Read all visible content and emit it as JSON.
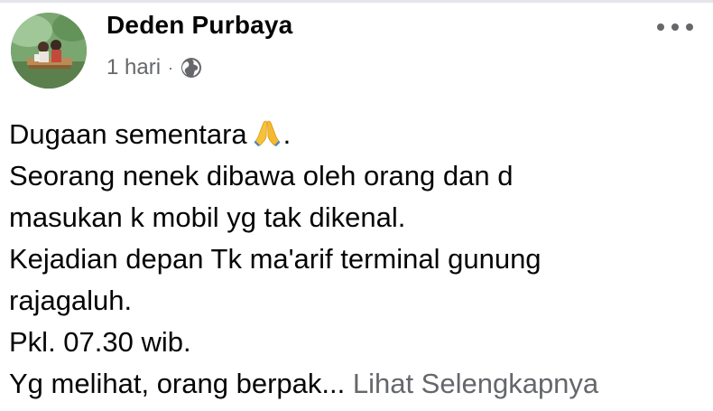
{
  "post": {
    "author": "Deden Purbaya",
    "time": "1 hari",
    "separator": "·",
    "privacy_icon": "globe-icon",
    "more_icon": "more-options-icon",
    "body_lines": [
      "Dugaan sementara",
      ".",
      "Seorang nenek dibawa oleh orang dan d",
      "masukan k mobil yg tak dikenal.",
      "Kejadian depan Tk ma'arif terminal gunung",
      "rajagaluh.",
      "Pkl. 07.30 wib.",
      "Yg melihat, orang berpak..."
    ],
    "emoji_icon": "folded-hands-icon",
    "see_more": "Lihat Selengkapnya"
  },
  "colors": {
    "text": "#050505",
    "secondary": "#65676b",
    "divider": "#e4e6eb"
  }
}
